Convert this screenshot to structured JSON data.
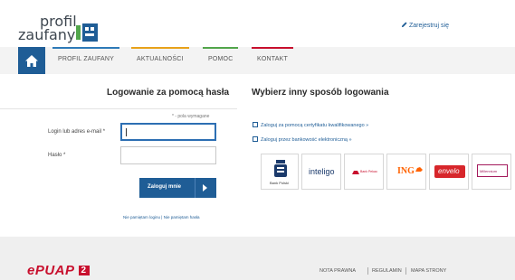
{
  "header": {
    "logo_line1": "profil",
    "logo_line2": "zaufany",
    "register_label": "Zarejestruj się"
  },
  "nav": {
    "items": [
      {
        "label": "PROFIL ZAUFANY",
        "color": "#2e7ab8"
      },
      {
        "label": "AKTUALNOŚCI",
        "color": "#e8a21a"
      },
      {
        "label": "POMOC",
        "color": "#52a64b"
      },
      {
        "label": "KONTAKT",
        "color": "#c8102e"
      }
    ]
  },
  "login": {
    "title": "Logowanie za pomocą hasła",
    "required_note": "* - pola wymagane",
    "login_label": "Login lub adres e-mail *",
    "login_value": "",
    "password_label": "Hasło *",
    "password_value": "",
    "submit_label": "Zaloguj mnie",
    "forgot_link": "Nie pamiętam loginu | Nie pamiętam hasła"
  },
  "other": {
    "title": "Wybierz inny sposób logowania",
    "cert_link": "Zaloguj za pomocą certyfikatu kwalifikowanego »",
    "bank_link": "Zaloguj przez bankowość elektroniczną »",
    "banks": [
      {
        "name": "Bank Polski",
        "logo": "pko-logo"
      },
      {
        "name": "inteligo",
        "logo": "inteligo-logo"
      },
      {
        "name": "Bank Pekao",
        "logo": "pekao-logo"
      },
      {
        "name": "ING",
        "logo": "ing-logo"
      },
      {
        "name": "envelo",
        "logo": "envelo-logo"
      },
      {
        "name": "Millennium",
        "logo": "millennium-logo"
      }
    ]
  },
  "footer": {
    "brand": "ePUAP",
    "brand_badge": "2",
    "links": [
      "NOTA PRAWNA",
      "REGULAMIN",
      "MAPA STRONY"
    ]
  },
  "colors": {
    "primary": "#1f5d96",
    "epuap_red": "#c8102e"
  }
}
